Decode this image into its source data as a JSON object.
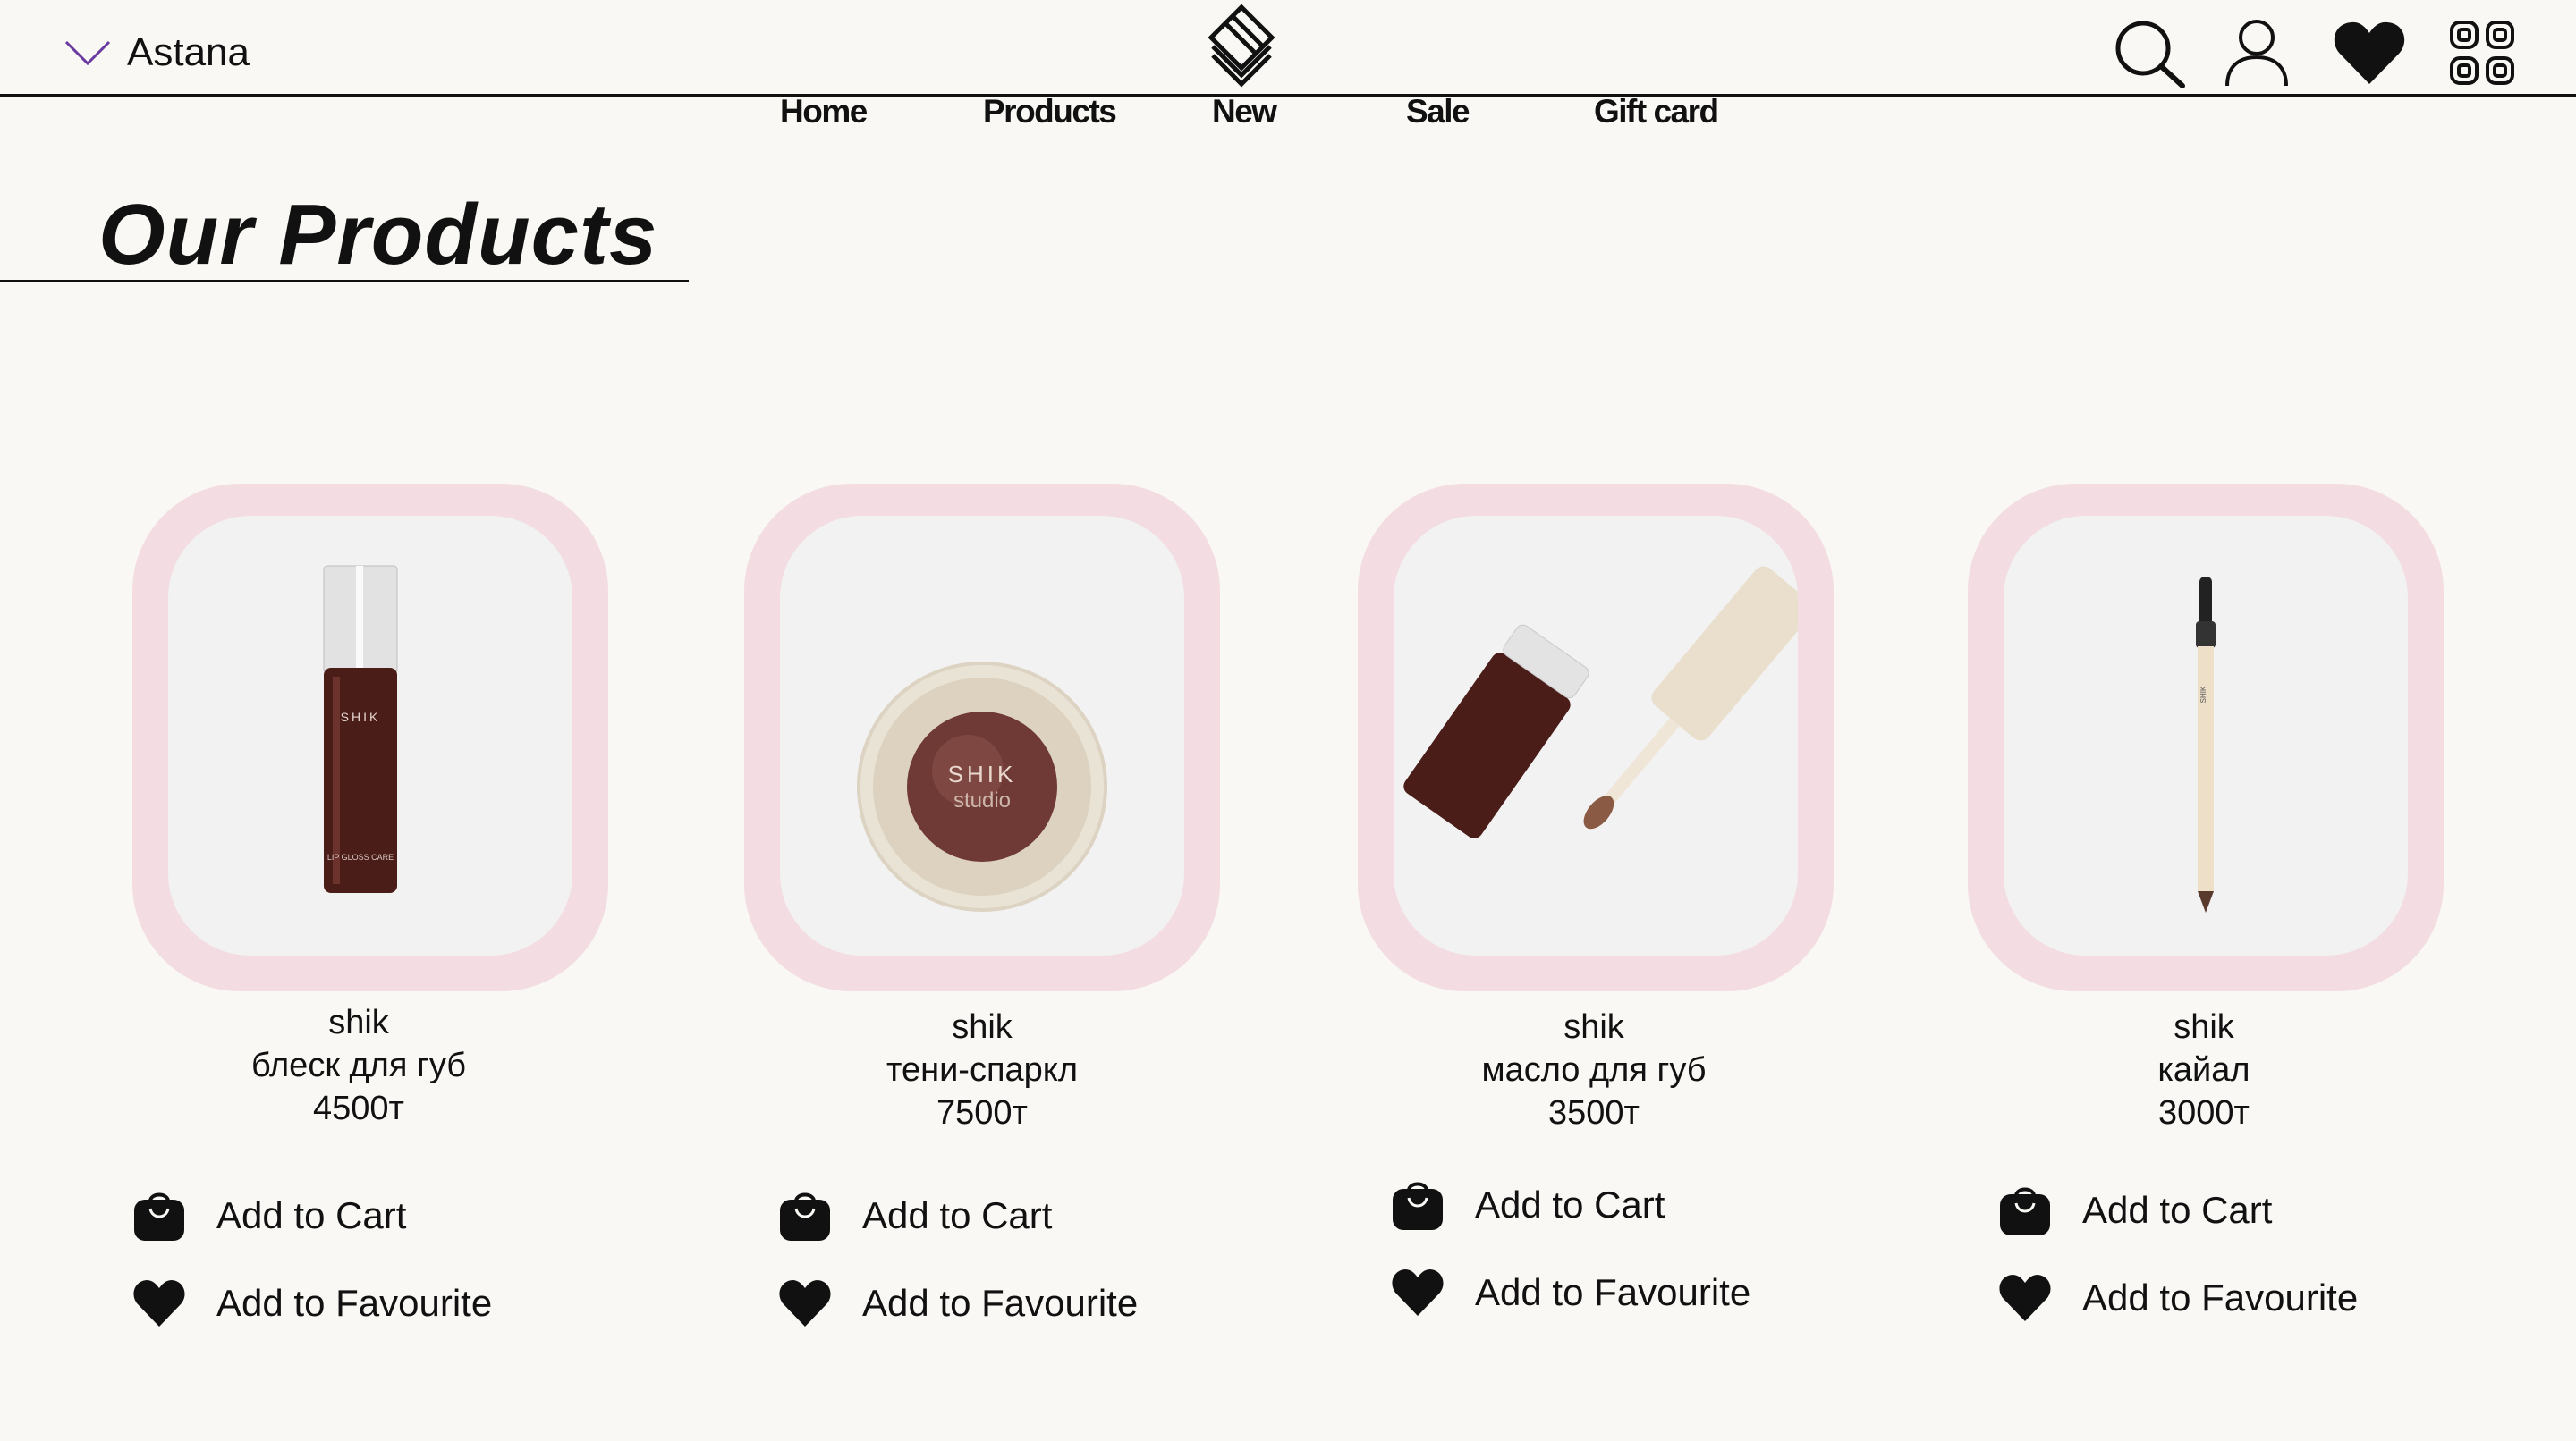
{
  "header": {
    "city": "Astana",
    "nav": [
      "Home",
      "Products",
      "New",
      "Sale",
      "Gift card"
    ]
  },
  "page_title": "Our Products",
  "products": [
    {
      "brand": "shik",
      "name": "блеск для губ",
      "price": "4500т",
      "cart_label": "Add to Cart",
      "fav_label": "Add to Favourite",
      "image": "lip-gloss-bottle"
    },
    {
      "brand": "shik",
      "name": "тени-спаркл",
      "price": "7500т",
      "cart_label": "Add to Cart",
      "fav_label": "Add to Favourite",
      "image": "eyeshadow-compact"
    },
    {
      "brand": "shik",
      "name": "масло для губ",
      "price": "3500т",
      "cart_label": "Add to Cart",
      "fav_label": "Add to Favourite",
      "image": "lip-oil-tube"
    },
    {
      "brand": "shik",
      "name": "кайал",
      "price": "3000т",
      "cart_label": "Add to Cart",
      "fav_label": "Add to Favourite",
      "image": "kajal-pencil"
    }
  ],
  "colors": {
    "background": "#f9f8f4",
    "frame": "#f3dde2",
    "product": "#4a1d18"
  }
}
